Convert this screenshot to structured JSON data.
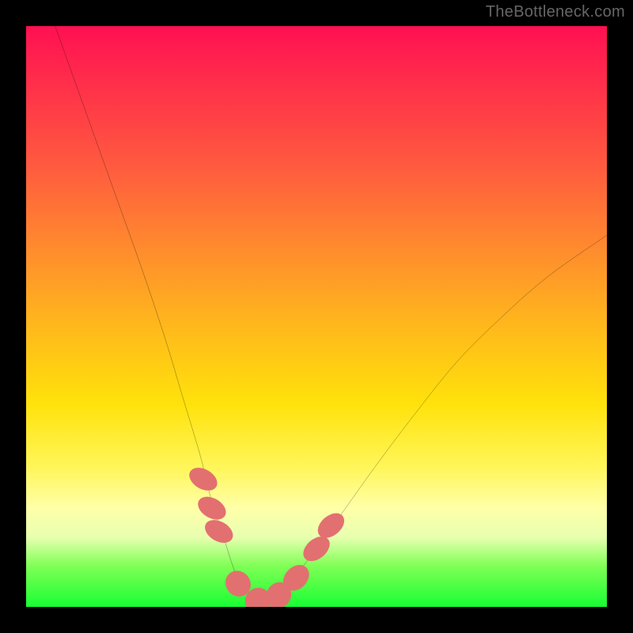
{
  "watermark": "TheBottleneck.com",
  "chart_data": {
    "type": "line",
    "title": "",
    "xlabel": "",
    "ylabel": "",
    "xlim": [
      0,
      100
    ],
    "ylim": [
      0,
      100
    ],
    "grid": false,
    "legend": false,
    "series": [
      {
        "name": "bottleneck-curve",
        "color": "#000000",
        "x": [
          5,
          10,
          15,
          20,
          24,
          27,
          30,
          32,
          34,
          36,
          38,
          40,
          42,
          46,
          50,
          55,
          60,
          66,
          74,
          82,
          90,
          100
        ],
        "values": [
          100,
          86,
          72,
          58,
          46,
          36,
          26,
          18,
          12,
          6,
          3,
          1,
          1,
          5,
          10,
          17,
          24,
          32,
          42,
          50,
          57,
          64
        ]
      }
    ],
    "markers": [
      {
        "name": "left-descent-dot-1",
        "x": 30.5,
        "y": 22,
        "shape": "ellipse",
        "rx": 1.7,
        "ry": 2.6,
        "rotate": -60,
        "color": "#e27070"
      },
      {
        "name": "left-descent-dot-2",
        "x": 32.0,
        "y": 17,
        "shape": "ellipse",
        "rx": 1.7,
        "ry": 2.6,
        "rotate": -60,
        "color": "#e27070"
      },
      {
        "name": "left-descent-dot-3",
        "x": 33.2,
        "y": 13,
        "shape": "ellipse",
        "rx": 1.7,
        "ry": 2.6,
        "rotate": -60,
        "color": "#e27070"
      },
      {
        "name": "bottom-left-dot",
        "x": 36.5,
        "y": 4,
        "shape": "ellipse",
        "rx": 2.1,
        "ry": 2.3,
        "rotate": -40,
        "color": "#e27070"
      },
      {
        "name": "bottom-mid-dot",
        "x": 40.0,
        "y": 1,
        "shape": "circle",
        "r": 2.3,
        "color": "#e27070"
      },
      {
        "name": "bottom-right-dot-1",
        "x": 43.5,
        "y": 2,
        "shape": "ellipse",
        "rx": 2.1,
        "ry": 2.3,
        "rotate": 30,
        "color": "#e27070"
      },
      {
        "name": "bottom-right-dot-2",
        "x": 46.5,
        "y": 5,
        "shape": "ellipse",
        "rx": 1.9,
        "ry": 2.5,
        "rotate": 45,
        "color": "#e27070"
      },
      {
        "name": "right-ascent-dot-1",
        "x": 50.0,
        "y": 10,
        "shape": "ellipse",
        "rx": 1.7,
        "ry": 2.6,
        "rotate": 50,
        "color": "#e27070"
      },
      {
        "name": "right-ascent-dot-2",
        "x": 52.5,
        "y": 14,
        "shape": "ellipse",
        "rx": 1.7,
        "ry": 2.6,
        "rotate": 50,
        "color": "#e27070"
      }
    ],
    "gradient_stops": [
      {
        "pos": 0,
        "color": "#ff1052"
      },
      {
        "pos": 10,
        "color": "#ff2f4a"
      },
      {
        "pos": 24,
        "color": "#ff5a3f"
      },
      {
        "pos": 38,
        "color": "#ff8a2e"
      },
      {
        "pos": 52,
        "color": "#ffb91b"
      },
      {
        "pos": 65,
        "color": "#ffe20b"
      },
      {
        "pos": 76,
        "color": "#fff65a"
      },
      {
        "pos": 83,
        "color": "#ffffa8"
      },
      {
        "pos": 88,
        "color": "#e8ffb0"
      },
      {
        "pos": 93,
        "color": "#7fff55"
      },
      {
        "pos": 100,
        "color": "#18ff33"
      }
    ]
  }
}
